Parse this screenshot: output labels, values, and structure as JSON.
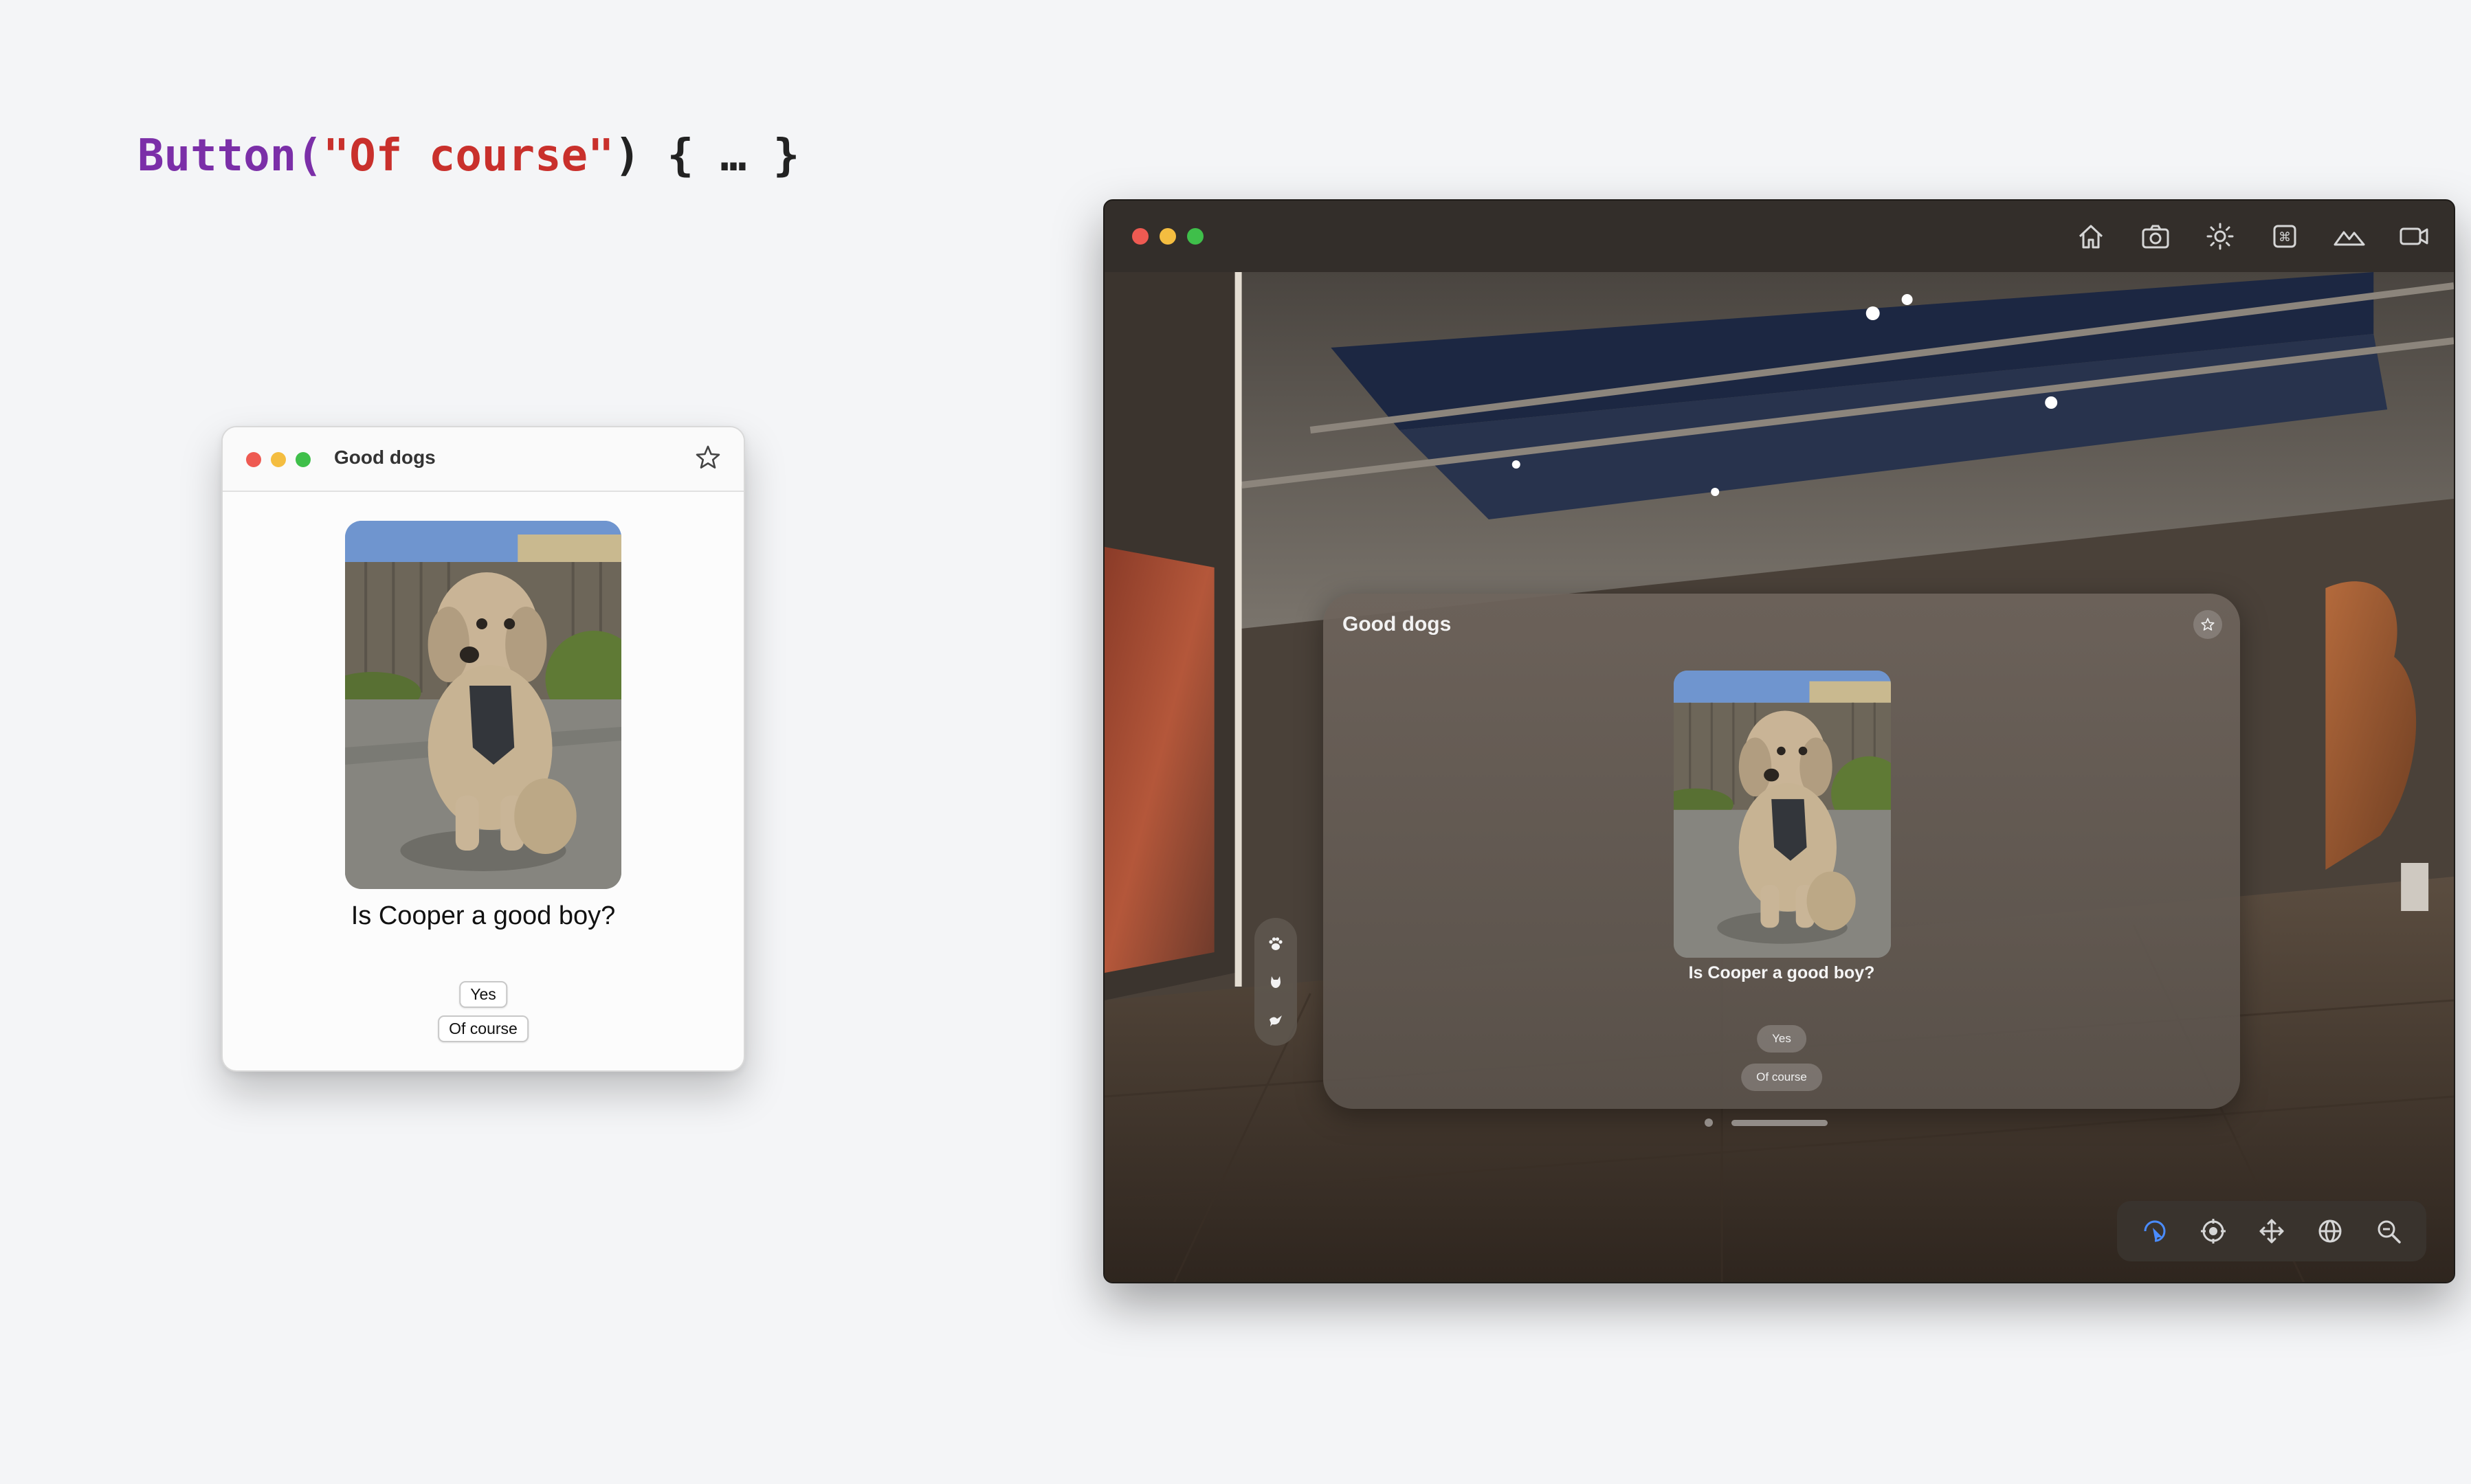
{
  "code_snippet": {
    "keyword": "Button(",
    "string": "\"Of course\"",
    "rest": ") { … }"
  },
  "mac_window": {
    "title": "Good dogs",
    "question": "Is Cooper a good boy?",
    "buttons": [
      "Yes",
      "Of course"
    ],
    "traffic_lights": [
      "#ee5a52",
      "#f4bd40",
      "#3fbf4a"
    ]
  },
  "simulator": {
    "toolbar_icons": [
      "home-icon",
      "camera-icon",
      "brightness-icon",
      "command-icon",
      "mountain-icon",
      "video-icon"
    ],
    "window_title": "Good dogs",
    "question": "Is Cooper a good boy?",
    "buttons": [
      "Yes",
      "Of course"
    ],
    "tab_icons": [
      "paw-icon",
      "cat-icon",
      "bird-icon"
    ],
    "bottom_tools": [
      "pointer-icon",
      "crosshair-icon",
      "move-icon",
      "globe-icon",
      "zoom-icon"
    ],
    "active_tool_color": "#4a8cff"
  }
}
